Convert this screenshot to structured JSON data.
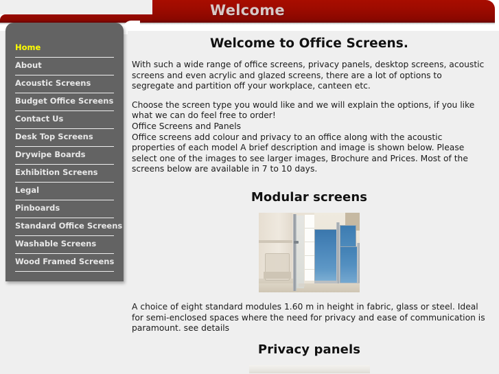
{
  "banner": {
    "title": "Welcome",
    "red": "#9d0b00",
    "title_color": "#d8c8c6"
  },
  "sidebar": {
    "bg": "#636363",
    "active_color": "#ffff00",
    "items": [
      {
        "label": "Home",
        "active": true
      },
      {
        "label": "About",
        "active": false
      },
      {
        "label": "Acoustic Screens",
        "active": false
      },
      {
        "label": "Budget Office Screens",
        "active": false
      },
      {
        "label": "Contact Us",
        "active": false
      },
      {
        "label": "Desk Top Screens",
        "active": false
      },
      {
        "label": "Drywipe Boards",
        "active": false
      },
      {
        "label": "Exhibition Screens",
        "active": false
      },
      {
        "label": "Legal",
        "active": false
      },
      {
        "label": "Pinboards",
        "active": false
      },
      {
        "label": "Standard Office Screens",
        "active": false
      },
      {
        "label": "Washable Screens",
        "active": false
      },
      {
        "label": "Wood Framed Screens",
        "active": false
      }
    ]
  },
  "main": {
    "heading": "Welcome to Office Screens.",
    "paragraph_1": "With such a wide range of office screens, privacy panels, desktop screens, acoustic screens and even acrylic and glazed screens, there are a lot of options to segregate and partition off your workplace, canteen etc.",
    "paragraph_2": "Choose the screen type you would like and we will explain the options, if you like what we can do feel free to order!",
    "paragraph_3": "Office Screens and Panels",
    "paragraph_4": "Office screens add colour and privacy to an office along with the acoustic properties of each model  A brief description and image is shown below.  Please select one of the images to see larger images, Brochure and Prices.  Most of the screens below are available in 7 to 10 days.",
    "sections": [
      {
        "heading": "Modular screens",
        "image_alt": "office-screens-photo",
        "description": "A choice of eight standard modules 1.60 m in height in fabric, glass or steel. Ideal for semi-enclosed spaces where the need for privacy and ease of communication is paramount. see details"
      },
      {
        "heading": "Privacy panels"
      }
    ]
  }
}
